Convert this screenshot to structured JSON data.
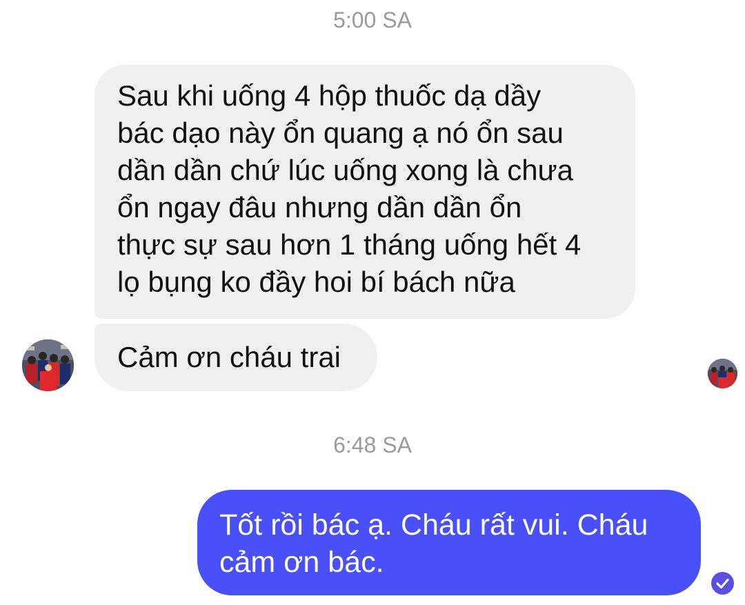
{
  "messages": [
    {
      "timestamp": "5:00 SA",
      "direction": "incoming",
      "text": "Sau khi uống 4 hộp thuốc dạ dầy\nbác dạo này ổn quang ạ nó ổn sau\ndần dần chứ lúc uống xong là chưa\nổn ngay đâu  nhưng dần dần ổn\nthực sự sau hơn 1 tháng uống hết 4\nlọ bụng ko đầy hoi bí bách nữa"
    },
    {
      "direction": "incoming",
      "text": "Cảm ơn cháu trai"
    },
    {
      "timestamp": "6:48 SA",
      "direction": "outgoing",
      "text": "Tốt rồi bác ạ. Cháu rất vui. Cháu\ncảm ơn bác."
    }
  ],
  "icons": {
    "contact_avatar": "avatar-photo-icon",
    "read_receipt_avatar": "avatar-photo-icon",
    "delivered_status": "check-circle-icon"
  },
  "colors": {
    "outgoing_bubble": "#4a50f7",
    "incoming_bubble": "#f0f0f0",
    "timestamp_text": "#9a9a9a",
    "status_icon": "#5b4fe0"
  }
}
